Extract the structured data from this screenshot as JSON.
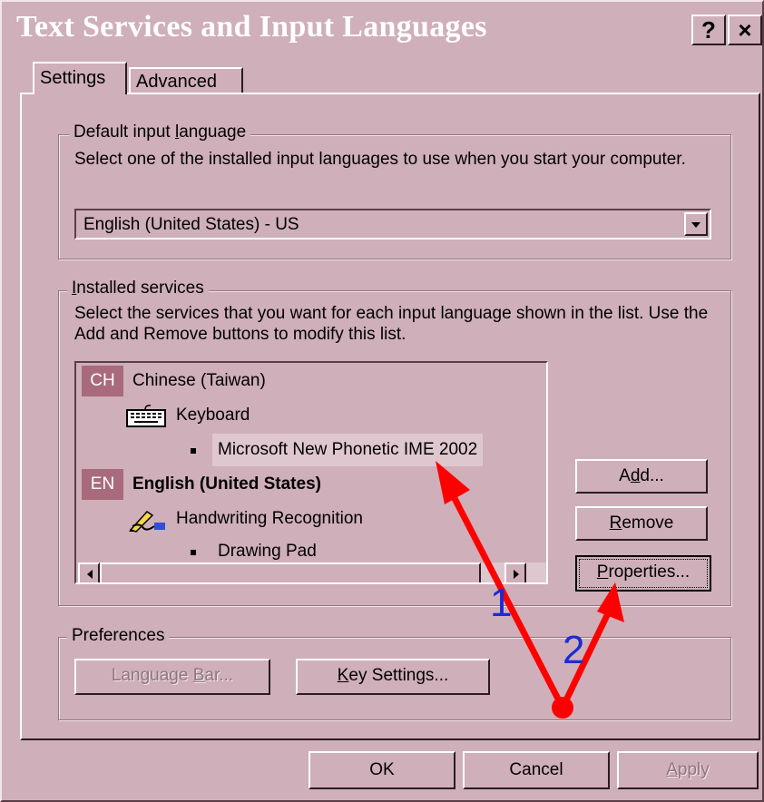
{
  "window": {
    "title": "Text Services and Input Languages",
    "help_label": "?",
    "close_label": "×"
  },
  "tabs": [
    {
      "label": "Settings",
      "selected": true
    },
    {
      "label": "Advanced",
      "selected": false
    }
  ],
  "default_input": {
    "group_label_prefix": "Default input ",
    "group_label_mnemonic": "l",
    "group_label_suffix": "anguage",
    "description": "Select one of the installed input languages to use when you start your computer.",
    "selected_value": "English (United States) - US"
  },
  "installed_services": {
    "group_label_prefix": "",
    "group_label_mnemonic": "I",
    "group_label_suffix": "nstalled services",
    "description": "Select the services that you want for each input language shown in the list. Use the Add and Remove buttons to modify this list.",
    "tree": [
      {
        "badge": "CH",
        "label": "Chinese (Taiwan)"
      },
      {
        "label": "Keyboard",
        "icon": "keyboard-icon"
      },
      {
        "label": "Microsoft New Phonetic IME 2002",
        "selected": true
      },
      {
        "badge": "EN",
        "label": "English (United States)",
        "bold": true
      },
      {
        "label": "Handwriting Recognition",
        "icon": "pen-icon"
      },
      {
        "label": "Drawing Pad"
      }
    ],
    "buttons": {
      "add_prefix": "A",
      "add_mnemonic": "d",
      "add_suffix": "d...",
      "remove_prefix": "",
      "remove_mnemonic": "R",
      "remove_suffix": "emove",
      "properties_prefix": "",
      "properties_mnemonic": "P",
      "properties_suffix": "roperties..."
    }
  },
  "preferences": {
    "group_label": "Preferences",
    "language_bar_prefix": "Language ",
    "language_bar_mnemonic": "B",
    "language_bar_suffix": "ar...",
    "key_settings_prefix": "",
    "key_settings_mnemonic": "K",
    "key_settings_suffix": "ey Settings..."
  },
  "dialog_buttons": {
    "ok": "OK",
    "cancel": "Cancel",
    "apply_prefix": "",
    "apply_mnemonic": "A",
    "apply_suffix": "pply"
  },
  "annotations": {
    "label_1": "1",
    "label_2": "2",
    "arrow_color": "#ff0000",
    "label_color": "#1c2bd2"
  },
  "colors": {
    "face": "#cfafb9",
    "badge": "#a86a7c",
    "selection": "#dfc7cf"
  }
}
